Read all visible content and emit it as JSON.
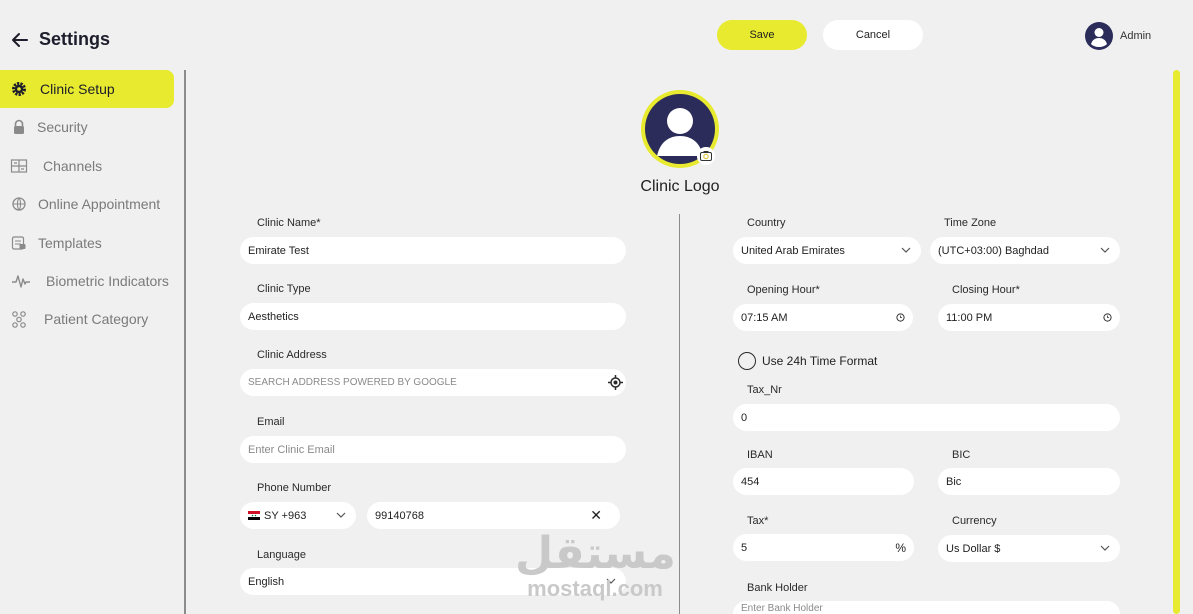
{
  "header": {
    "title": "Settings",
    "save_label": "Save",
    "cancel_label": "Cancel",
    "user_name": "Admin"
  },
  "sidebar": {
    "items": [
      {
        "label": "Clinic Setup",
        "icon": "gear-icon",
        "active": true
      },
      {
        "label": "Security",
        "icon": "lock-icon"
      },
      {
        "label": "Channels",
        "icon": "channels-icon"
      },
      {
        "label": "Online Appointment",
        "icon": "globe-icon"
      },
      {
        "label": "Templates",
        "icon": "templates-icon"
      },
      {
        "label": "Biometric Indicators",
        "icon": "pulse-icon"
      },
      {
        "label": "Patient Category",
        "icon": "category-icon"
      }
    ]
  },
  "logo": {
    "label": "Clinic Logo"
  },
  "left_form": {
    "clinic_name": {
      "label": "Clinic Name*",
      "value": "Emirate Test"
    },
    "clinic_type": {
      "label": "Clinic Type",
      "value": "Aesthetics"
    },
    "clinic_address": {
      "label": "Clinic Address",
      "placeholder": "SEARCH ADDRESS POWERED BY GOOGLE"
    },
    "email": {
      "label": "Email",
      "placeholder": "Enter Clinic Email"
    },
    "phone": {
      "label": "Phone Number",
      "country_code": "SY +963",
      "number": "99140768"
    },
    "language": {
      "label": "Language",
      "value": "English"
    }
  },
  "right_form": {
    "country": {
      "label": "Country",
      "value": "United Arab Emirates"
    },
    "time_zone": {
      "label": "Time Zone",
      "value": "(UTC+03:00) Baghdad"
    },
    "opening_hour": {
      "label": "Opening Hour*",
      "value": "07:15 AM"
    },
    "closing_hour": {
      "label": "Closing Hour*",
      "value": "11:00 PM"
    },
    "time_format": {
      "label": "Use 24h Time Format",
      "checked": false
    },
    "tax_nr": {
      "label": "Tax_Nr",
      "value": "0"
    },
    "iban": {
      "label": "IBAN",
      "value": "454"
    },
    "bic": {
      "label": "BIC",
      "value": "Bic"
    },
    "tax": {
      "label": "Tax*",
      "value": "5",
      "suffix": "%"
    },
    "currency": {
      "label": "Currency",
      "value": "Us Dollar $"
    },
    "bank_holder": {
      "label": "Bank Holder",
      "placeholder": "Enter Bank Holder"
    }
  },
  "watermark": {
    "arabic": "مستقل",
    "latin": "mostaql.com"
  },
  "colors": {
    "accent": "#e7ea2e",
    "avatar": "#2c2c5a",
    "background": "#f0f0f0"
  }
}
